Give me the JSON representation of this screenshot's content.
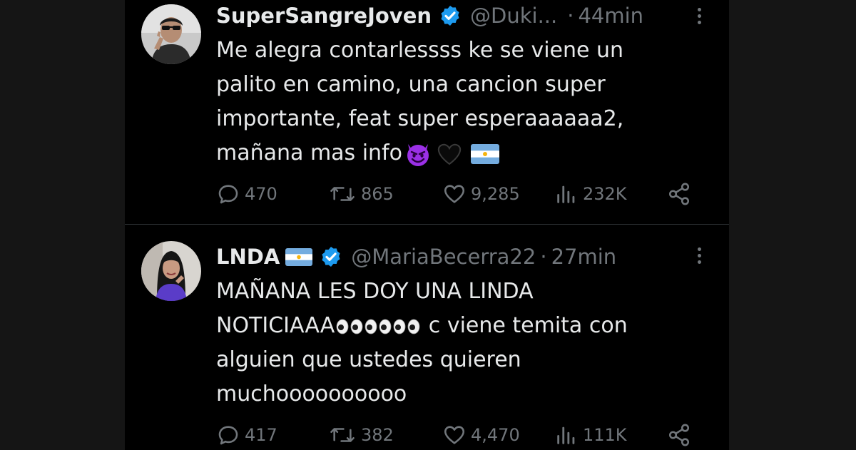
{
  "tweets": [
    {
      "name": "SuperSangreJoven",
      "handle": "@Duki...",
      "separator": "·",
      "time": "44min",
      "lines": [
        "Me alegra contarlessss ke se viene un",
        "palito en camino, una cancion super",
        "importante, feat super esperaaaaaa2,",
        "mañana mas info"
      ],
      "emojis": [
        "smiling-imp-emoji",
        "black-heart-emoji",
        "argentina-flag-emoji"
      ],
      "stats": {
        "replies": "470",
        "retweets": "865",
        "likes": "9,285",
        "views": "232K"
      }
    },
    {
      "name": "LNDA",
      "name_flag": "argentina-flag-emoji",
      "handle": "@MariaBecerra22",
      "separator": "·",
      "time": "27min",
      "lines": [
        "MAÑANA LES DOY UNA LINDA",
        "NOTICIAAA",
        " c viene temita con",
        "alguien que ustedes quieren",
        "muchoooooooooo"
      ],
      "emojis": [
        "eyes-emoji"
      ],
      "stats": {
        "replies": "417",
        "retweets": "382",
        "likes": "4,470",
        "views": "111K"
      }
    }
  ],
  "colors": {
    "background": "#000000",
    "side_panels": "#151515",
    "text": "#e7e9ea",
    "muted": "#71767b",
    "verified": "#1d9bf0",
    "divider": "#2f3336"
  },
  "icons": [
    "reply-icon",
    "retweet-icon",
    "like-icon",
    "views-icon",
    "share-icon",
    "more-icon",
    "verified-badge-icon"
  ]
}
